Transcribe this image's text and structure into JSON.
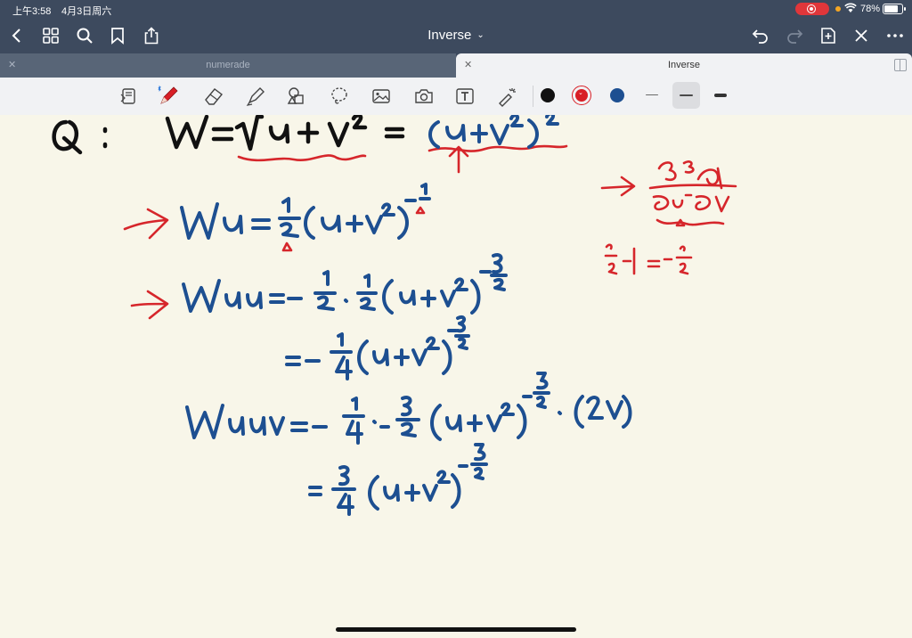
{
  "status_bar": {
    "time": "上午3:58",
    "date": "4月3日周六",
    "battery_percent": "78%",
    "battery_level": 0.78
  },
  "nav": {
    "title": "Inverse",
    "icons": [
      "back-icon",
      "grid-icon",
      "search-icon",
      "bookmark-icon",
      "share-icon",
      "undo-icon",
      "redo-icon",
      "add-page-icon",
      "close-icon",
      "more-icon"
    ]
  },
  "tabs": [
    {
      "label": "numerade",
      "active": false
    },
    {
      "label": "Inverse",
      "active": true
    }
  ],
  "toolbar": {
    "tools": [
      "read-mode-icon",
      "pen-icon",
      "eraser-icon",
      "highlighter-icon",
      "shapes-icon",
      "lasso-icon",
      "image-icon",
      "camera-icon",
      "text-icon",
      "laser-pointer-icon"
    ],
    "colors": {
      "black": "#111111",
      "red": "#d81f26",
      "blue": "#1d4f91"
    },
    "selected_color": "red",
    "selected_thickness": "medium"
  },
  "canvas": {
    "background": "#f8f6e9",
    "ink_colors": {
      "black": "#111111",
      "red": "#d6262b",
      "blue": "#1d4f91"
    }
  }
}
